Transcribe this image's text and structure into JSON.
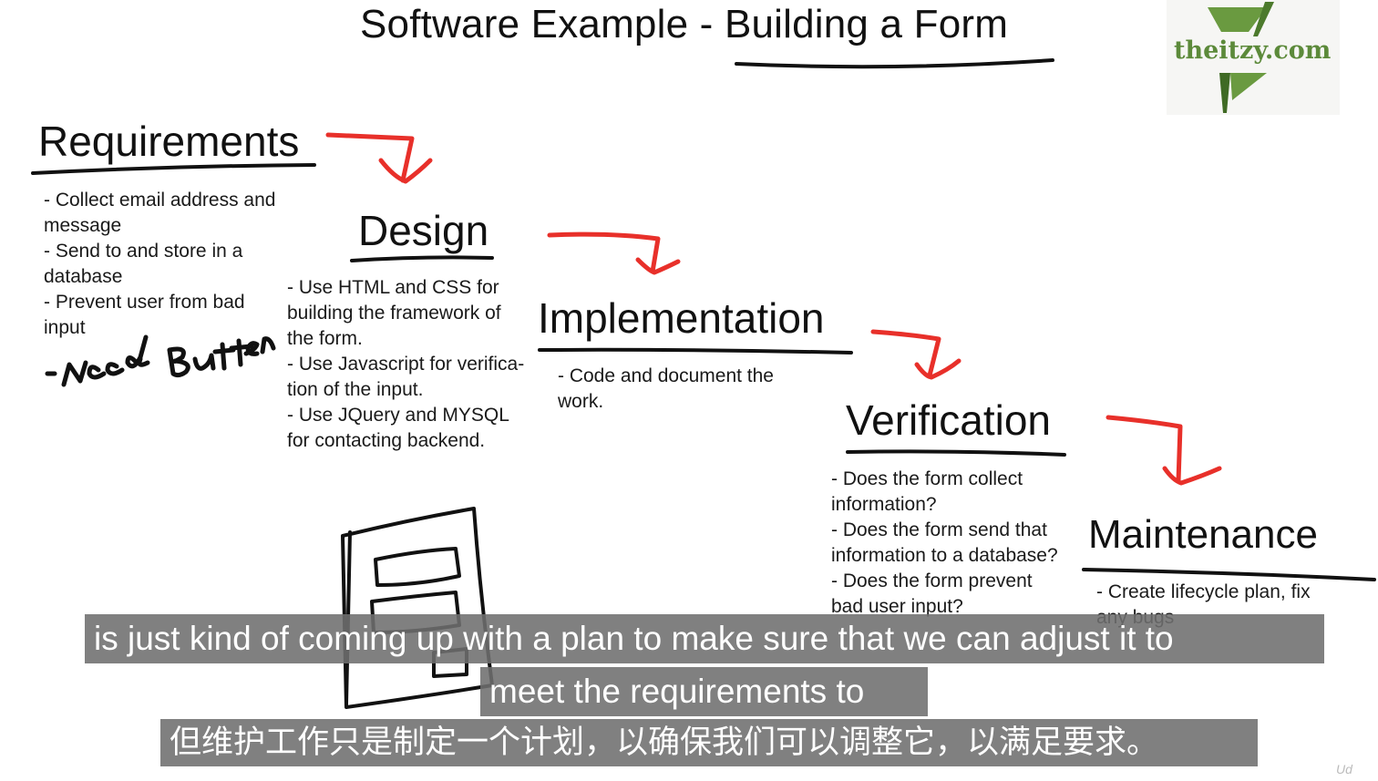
{
  "title": "Software Example - Building a Form",
  "logo": {
    "text": "theitzy.com",
    "color": "#5c8a3a"
  },
  "colors": {
    "arrow": "#e8302a",
    "ink": "#111111",
    "subtitle_bg": "#6e6e6e"
  },
  "stages": {
    "requirements": {
      "heading": "Requirements",
      "lines": [
        "- Collect email address and",
        "message",
        "- Send to and store in a",
        "database",
        "- Prevent user from bad",
        "input"
      ],
      "handwritten_note": "- Needs Button"
    },
    "design": {
      "heading": "Design",
      "lines": [
        "- Use HTML and CSS for",
        "building the framework of",
        "the form.",
        "- Use Javascript for verifica-",
        "tion of the input.",
        "- Use JQuery and MYSQL",
        "for contacting backend."
      ]
    },
    "implementation": {
      "heading": "Implementation",
      "lines": [
        "- Code and document the",
        "work."
      ]
    },
    "verification": {
      "heading": "Verification",
      "lines": [
        "- Does the form collect",
        "information?",
        "- Does the form send that",
        "information to a database?",
        "- Does the form prevent",
        "bad user input?"
      ]
    },
    "maintenance": {
      "heading": "Maintenance",
      "lines": [
        "- Create lifecycle plan, fix",
        "any bugs"
      ]
    }
  },
  "subtitles": {
    "line1": "is just kind of coming up with a plan to make sure that we can adjust it to",
    "line2": "meet the requirements to",
    "line3": "但维护工作只是制定一个计划，以确保我们可以调整它，以满足要求。"
  },
  "watermark": "Ud"
}
